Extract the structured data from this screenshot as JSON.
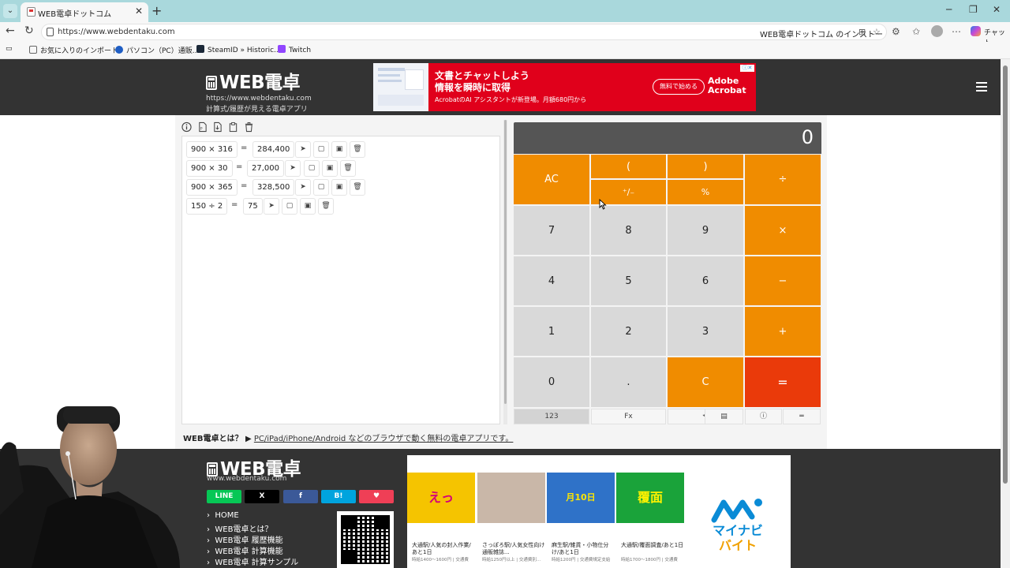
{
  "browser": {
    "tab_title": "WEB電卓ドットコム",
    "url": "https://www.webdentaku.com",
    "install_text": "WEB電卓ドットコム のインストール",
    "chat_label": "チャット",
    "bookmarks": [
      "お気に入りのインポート",
      "パソコン（PC）通販...",
      "SteamID » Historic...",
      "Twitch"
    ]
  },
  "site": {
    "logo": "WEB電卓",
    "url": "https://www.webdentaku.com",
    "tagline": "計算式/履歴が見える電卓アプリ",
    "ad": {
      "headline1": "文書とチャットしよう",
      "headline2": "情報を瞬時に取得",
      "sub": "AcrobatのAI アシスタントが新登場。月額680円から",
      "button": "無料で始める",
      "brand1": "Adobe",
      "brand2": "Acrobat"
    }
  },
  "history": [
    {
      "expr": "900 × 316",
      "eq": "=",
      "result": "284,400"
    },
    {
      "expr": "900 × 30",
      "eq": "=",
      "result": "27,000"
    },
    {
      "expr": "900 × 365",
      "eq": "=",
      "result": "328,500"
    },
    {
      "expr": "150 ÷ 2",
      "eq": "=",
      "result": "75"
    }
  ],
  "calculator": {
    "display": "0",
    "keys": {
      "ac": "AC",
      "lparen": "(",
      "rparen": ")",
      "divide": "÷",
      "pm": "⁺∕₋",
      "percent": "%",
      "seven": "7",
      "eight": "8",
      "nine": "9",
      "multiply": "×",
      "four": "4",
      "five": "5",
      "six": "6",
      "minus": "−",
      "one": "1",
      "two": "2",
      "three": "3",
      "plus": "+",
      "zero": "0",
      "dot": ".",
      "clear": "C",
      "equals": "="
    },
    "bottom": [
      "123",
      "Fx",
      "⟲",
      "▤",
      "ⓘ",
      "═"
    ]
  },
  "about": {
    "label": "WEB電卓とは？ ▶",
    "link": "PC/iPad/iPhone/Android などのブラウザで動く無料の電卓アプリです。"
  },
  "footer": {
    "logo": "WEB電卓",
    "url": "www.webdentaku.com",
    "share": [
      "LINE",
      "X",
      "f",
      "B!",
      "♥"
    ],
    "links": [
      "HOME",
      "WEB電卓とは？",
      "WEB電卓 履歴機能",
      "WEB電卓 計算機能",
      "WEB電卓 計算サンプル"
    ],
    "ads": [
      {
        "caption": "大通駅/人気の封入作業/あと1日",
        "sub": "時給1400〜1600円 | 交通費"
      },
      {
        "caption": "さっぽろ駅/人気女性向け通販雑誌...",
        "sub": "時給1250円以上 | 交通費別..."
      },
      {
        "caption": "麻生駅/雑貨・小物仕分け/あと1日",
        "sub": "時給1200円 | 交通費規定支給"
      },
      {
        "caption": "大通駅/覆面調査/あと1日",
        "sub": "時給1700〜1800円 | 交通費"
      }
    ],
    "mynavi_1": "マイナビ",
    "mynavi_2": "バイト"
  },
  "colors": {
    "orange": "#f08c00",
    "red": "#ea3a0a",
    "key_grey": "#d9d9d9",
    "header": "#333333"
  }
}
